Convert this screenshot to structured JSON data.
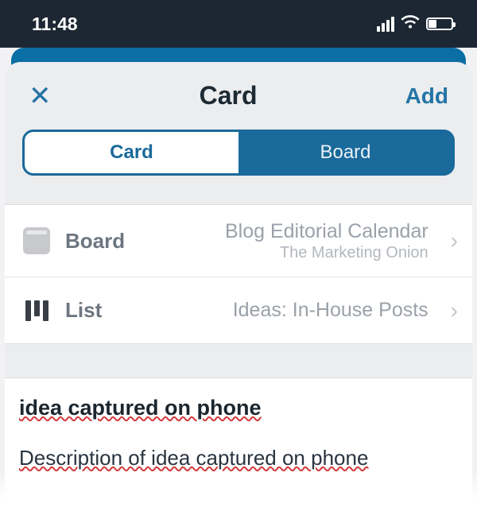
{
  "status": {
    "time": "11:48"
  },
  "modal": {
    "title": "Card",
    "add_label": "Add"
  },
  "segmented": {
    "tabs": [
      {
        "label": "Card",
        "active": true
      },
      {
        "label": "Board",
        "active": false
      }
    ]
  },
  "rows": {
    "board": {
      "label": "Board",
      "value": "Blog Editorial Calendar",
      "sub": "The Marketing Onion"
    },
    "list": {
      "label": "List",
      "value": "Ideas: In-House Posts"
    }
  },
  "card": {
    "title": "idea captured on phone",
    "description": "Description of idea captured on phone"
  }
}
